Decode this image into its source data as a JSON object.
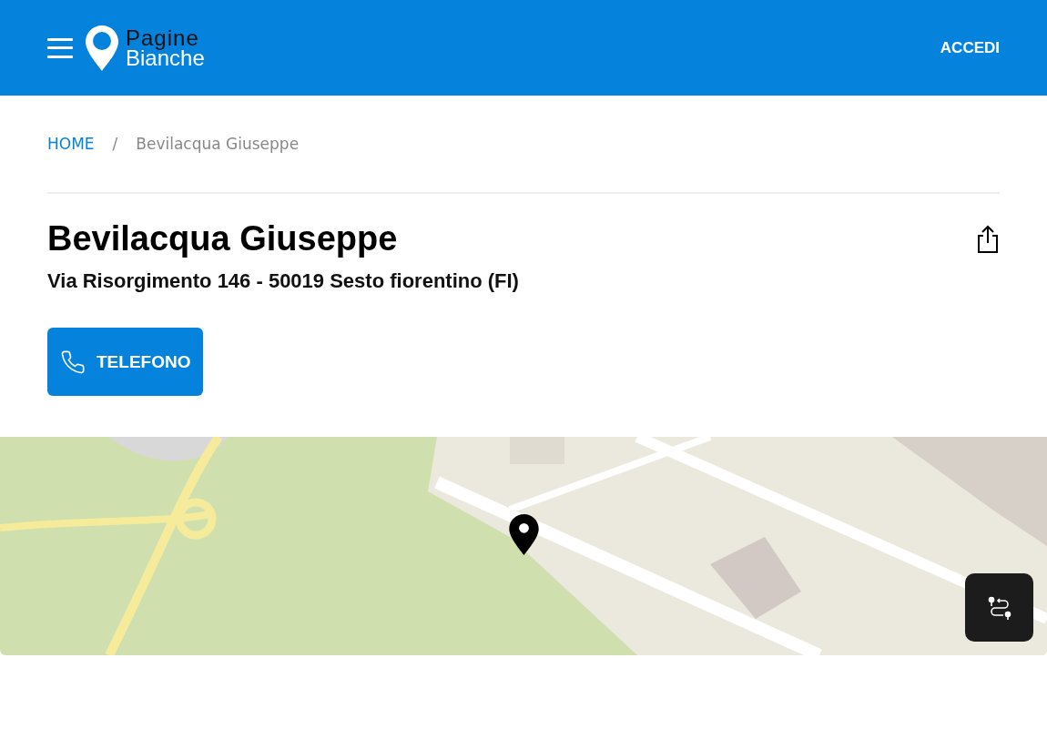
{
  "header": {
    "logo": {
      "line_1": "Pagine",
      "line_2": "Bianche"
    },
    "login": "ACCEDI"
  },
  "breadcrumb": [
    {
      "label": "HOME",
      "link": true
    },
    {
      "label": "/",
      "link": false
    },
    {
      "label": "Bevilacqua Giuseppe",
      "link": false
    }
  ],
  "listing": {
    "name": "Bevilacqua Giuseppe",
    "address": "Via Risorgimento 146 - 50019 Sesto fiorentino (FI)"
  },
  "actions": [
    {
      "label": "TELEFONO",
      "kind": "phone"
    }
  ]
}
